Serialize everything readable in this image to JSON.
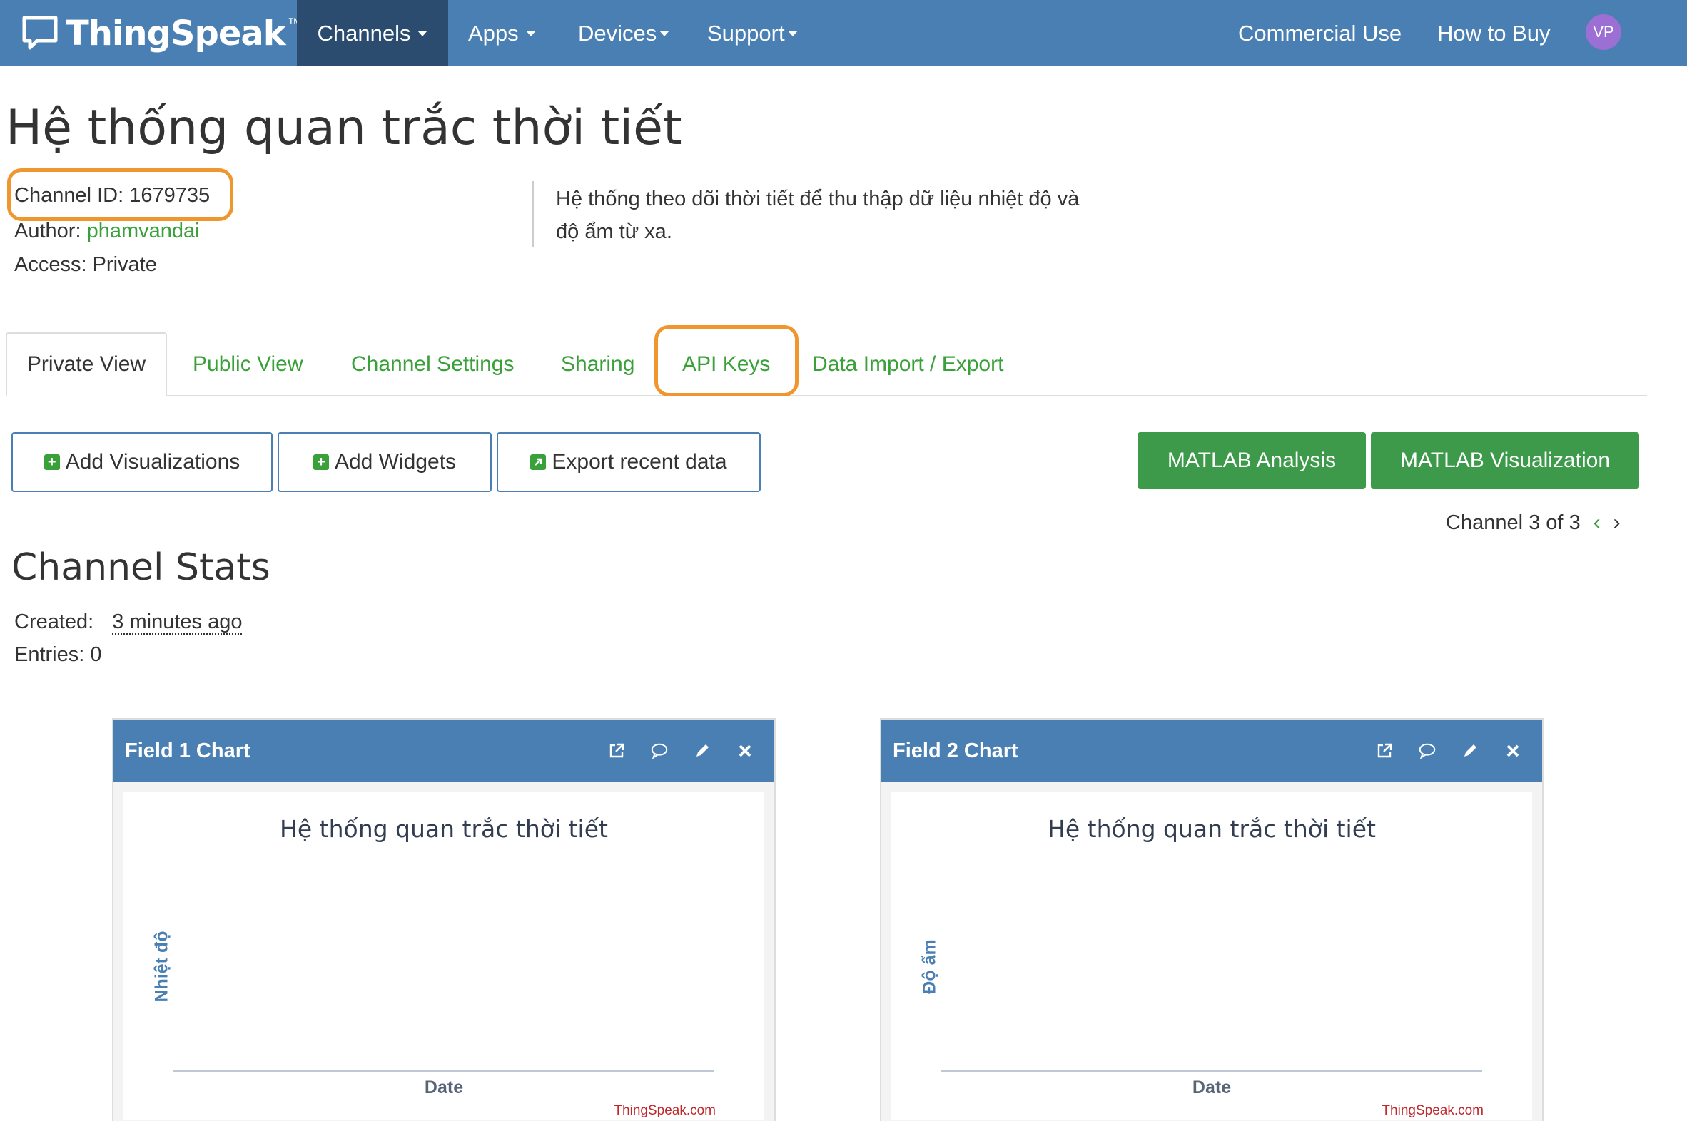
{
  "navbar": {
    "brand": "ThingSpeak",
    "brand_tm": "™",
    "items": [
      "Channels",
      "Apps",
      "Devices",
      "Support"
    ],
    "right_items": [
      "Commercial Use",
      "How to Buy"
    ],
    "avatar": "VP"
  },
  "channel": {
    "title": "Hệ thống quan trắc thời tiết",
    "id_label": "Channel ID:",
    "id_value": "1679735",
    "author_label": "Author:",
    "author_value": "phamvandai",
    "access_label": "Access:",
    "access_value": "Private",
    "description": "Hệ thống theo dõi thời tiết để thu thập dữ liệu nhiệt độ và độ ẩm từ xa."
  },
  "tabs": [
    "Private View",
    "Public View",
    "Channel Settings",
    "Sharing",
    "API Keys",
    "Data Import / Export"
  ],
  "buttons": {
    "add_visualizations": "Add Visualizations",
    "add_widgets": "Add Widgets",
    "export_recent": "Export recent data",
    "matlab_analysis": "MATLAB Analysis",
    "matlab_visualization": "MATLAB Visualization"
  },
  "pager": {
    "text": "Channel 3 of 3",
    "prev": "‹",
    "next": "›"
  },
  "stats": {
    "title": "Channel Stats",
    "created_label": "Created:",
    "created_value": "3 minutes ago",
    "entries_label": "Entries:",
    "entries_value": "0"
  },
  "charts": [
    {
      "panel_title": "Field 1 Chart",
      "chart_title": "Hệ thống quan trắc thời tiết",
      "ylabel": "Nhiệt độ",
      "xlabel": "Date",
      "credit": "ThingSpeak.com"
    },
    {
      "panel_title": "Field 2 Chart",
      "chart_title": "Hệ thống quan trắc thời tiết",
      "ylabel": "Độ ẩm",
      "xlabel": "Date",
      "credit": "ThingSpeak.com"
    }
  ],
  "colors": {
    "navbar": "#4a7fb3",
    "nav_active": "#2b4c6e",
    "link_green": "#3aa03a",
    "button_green": "#3d9a4a",
    "highlight_orange": "#f0962e"
  },
  "icons": {
    "brand": "speech-bubble-icon",
    "panel_tools": [
      "external-link-icon",
      "comment-icon",
      "pencil-icon",
      "close-icon"
    ]
  }
}
